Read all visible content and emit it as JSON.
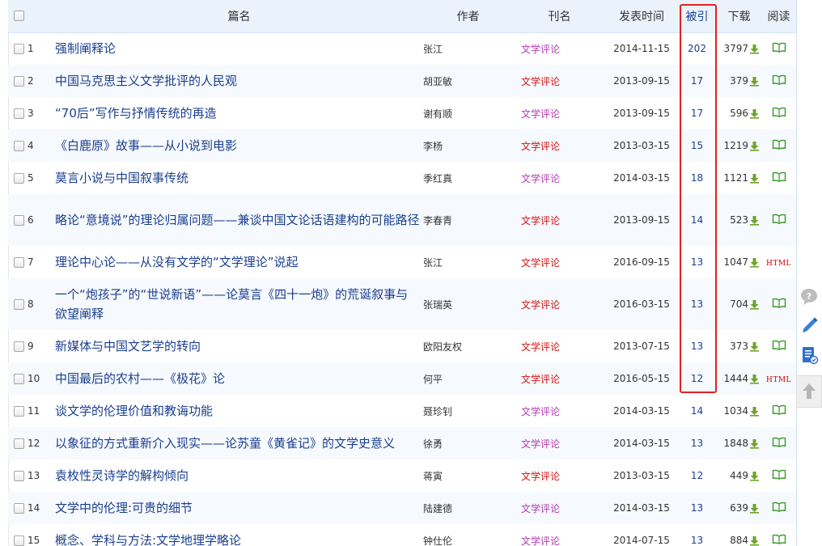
{
  "columns": {
    "title": "篇名",
    "author": "作者",
    "journal": "刊名",
    "date": "发表时间",
    "cited": "被引",
    "downloads": "下载",
    "read": "阅读"
  },
  "rows": [
    {
      "no": "1",
      "title": "强制阐释论",
      "author": "张江",
      "journal": "文学评论",
      "date": "2014-11-15",
      "cited": "202",
      "downloads": "3797",
      "read": "book"
    },
    {
      "no": "2",
      "title": "中国马克思主义文学批评的人民观",
      "author": "胡亚敏",
      "journal": "文学评论",
      "date": "2013-09-15",
      "cited": "17",
      "downloads": "379",
      "read": "book"
    },
    {
      "no": "3",
      "title": "“70后”写作与抒情传统的再造",
      "author": "谢有顺",
      "journal": "文学评论",
      "date": "2013-09-15",
      "cited": "17",
      "downloads": "596",
      "read": "book"
    },
    {
      "no": "4",
      "title": "《白鹿原》故事——从小说到电影",
      "author": "李杨",
      "journal": "文学评论",
      "date": "2013-03-15",
      "cited": "15",
      "downloads": "1219",
      "read": "book"
    },
    {
      "no": "5",
      "title": "莫言小说与中国叙事传统",
      "author": "季红真",
      "journal": "文学评论",
      "date": "2014-03-15",
      "cited": "18",
      "downloads": "1121",
      "read": "book"
    },
    {
      "no": "6",
      "title": "略论“意境说”的理论归属问题——兼谈中国文论话语建构的可能路径",
      "author": "李春青",
      "journal": "文学评论",
      "date": "2013-09-15",
      "cited": "14",
      "downloads": "523",
      "read": "book",
      "tall": true
    },
    {
      "no": "7",
      "title": "理论中心论——从没有文学的“文学理论”说起",
      "author": "张江",
      "journal": "文学评论",
      "date": "2016-09-15",
      "cited": "13",
      "downloads": "1047",
      "read": "html"
    },
    {
      "no": "8",
      "title": "一个“炮孩子”的“世说新语”——论莫言《四十一炮》的荒诞叙事与欲望阐释",
      "author": "张瑞英",
      "journal": "文学评论",
      "date": "2016-03-15",
      "cited": "13",
      "downloads": "704",
      "read": "book",
      "tall": true
    },
    {
      "no": "9",
      "title": "新媒体与中国文艺学的转向",
      "author": "欧阳友权",
      "journal": "文学评论",
      "date": "2013-07-15",
      "cited": "13",
      "downloads": "373",
      "read": "book"
    },
    {
      "no": "10",
      "title": "中国最后的农村——《极花》论",
      "author": "何平",
      "journal": "文学评论",
      "date": "2016-05-15",
      "cited": "12",
      "downloads": "1444",
      "read": "html"
    },
    {
      "no": "11",
      "title": "谈文学的伦理价值和教诲功能",
      "author": "聂珍钊",
      "journal": "文学评论",
      "date": "2014-03-15",
      "cited": "14",
      "downloads": "1034",
      "read": "book"
    },
    {
      "no": "12",
      "title": "以象征的方式重新介入现实——论苏童《黄雀记》的文学史意义",
      "author": "徐勇",
      "journal": "文学评论",
      "date": "2014-03-15",
      "cited": "13",
      "downloads": "1848",
      "read": "book"
    },
    {
      "no": "13",
      "title": "袁枚性灵诗学的解构倾向",
      "author": "蒋寅",
      "journal": "文学评论",
      "date": "2013-03-15",
      "cited": "12",
      "downloads": "449",
      "read": "book"
    },
    {
      "no": "14",
      "title": "文学中的伦理:可贵的细节",
      "author": "陆建德",
      "journal": "文学评论",
      "date": "2014-03-15",
      "cited": "13",
      "downloads": "639",
      "read": "book"
    },
    {
      "no": "15",
      "title": "概念、学科与方法:文学地理学略论",
      "author": "钟仕伦",
      "journal": "文学评论",
      "date": "2014-07-15",
      "cited": "13",
      "downloads": "884",
      "read": "book"
    }
  ],
  "read_html_label": "HTML",
  "colors": {
    "journal_purple": "#b23ab2",
    "journal_red": "#d21414",
    "highlight": "#e32222",
    "link": "#1a3f8f"
  },
  "journal_color_keys": [
    "purple",
    "red",
    "purple",
    "red",
    "purple",
    "red",
    "red",
    "red",
    "red",
    "red",
    "purple",
    "purple",
    "red",
    "purple",
    "purple"
  ],
  "sidebar": [
    "help-icon",
    "edit-icon",
    "notes-icon",
    "back-to-top-icon"
  ]
}
